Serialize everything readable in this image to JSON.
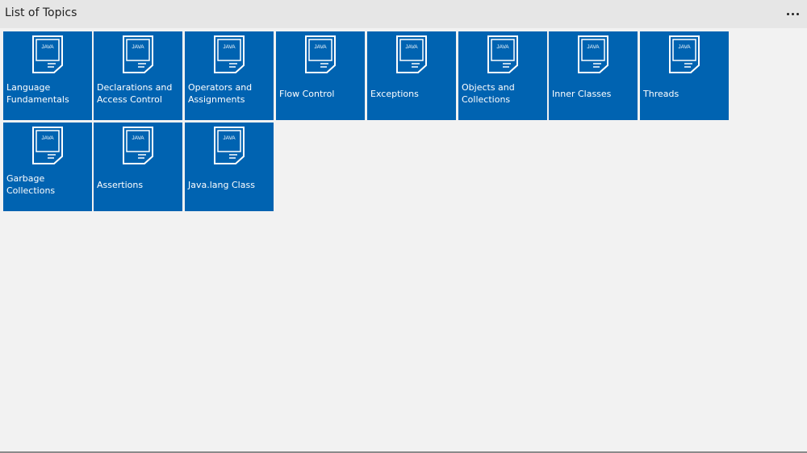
{
  "header": {
    "title": "List of Topics",
    "more_icon": "more-ellipsis-icon"
  },
  "colors": {
    "tile_blue": "#0063b1",
    "background": "#f2f2f2",
    "titlebar": "#e6e6e6"
  },
  "tile_icon": {
    "name": "java-file-icon",
    "text": "JAVA"
  },
  "tiles": [
    {
      "label": "Language\nFundamentals"
    },
    {
      "label": "Declarations and\nAccess Control"
    },
    {
      "label": "Operators and\nAssignments"
    },
    {
      "label": "Flow Control"
    },
    {
      "label": "Exceptions"
    },
    {
      "label": "Objects and\nCollections"
    },
    {
      "label": "Inner Classes"
    },
    {
      "label": "Threads"
    },
    {
      "label": "Garbage Collections"
    },
    {
      "label": "Assertions"
    },
    {
      "label": "Java.lang Class"
    }
  ]
}
